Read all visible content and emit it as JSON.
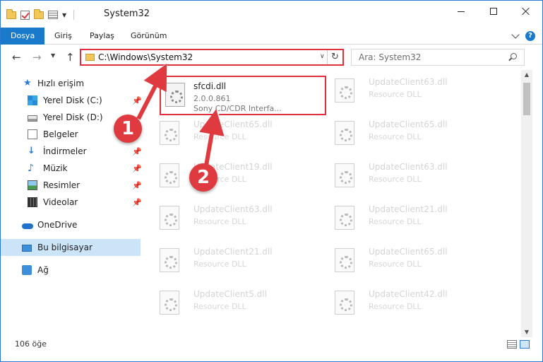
{
  "window": {
    "title": "System32",
    "controls": {
      "minimize": "minimize",
      "maximize": "maximize",
      "close": "close"
    }
  },
  "ribbon": {
    "tabs": [
      "Dosya",
      "Giriş",
      "Paylaş",
      "Görünüm"
    ]
  },
  "address": {
    "path": "C:\\Windows\\System32"
  },
  "search": {
    "placeholder": "Ara: System32"
  },
  "sidebar": {
    "items": [
      {
        "label": "Hızlı erişim",
        "icon": "star-icon",
        "pinned": false
      },
      {
        "label": "Yerel Disk (C:)",
        "icon": "drive-icon",
        "pinned": true
      },
      {
        "label": "Yerel Disk (D:)",
        "icon": "drive-icon",
        "pinned": false
      },
      {
        "label": "Belgeler",
        "icon": "document-icon",
        "pinned": true
      },
      {
        "label": "İndirmeler",
        "icon": "download-icon",
        "pinned": true
      },
      {
        "label": "Müzik",
        "icon": "music-icon",
        "pinned": true
      },
      {
        "label": "Resimler",
        "icon": "pictures-icon",
        "pinned": true
      },
      {
        "label": "Videolar",
        "icon": "videos-icon",
        "pinned": true
      },
      {
        "label": "OneDrive",
        "icon": "cloud-icon",
        "pinned": false
      },
      {
        "label": "Bu bilgisayar",
        "icon": "computer-icon",
        "pinned": false
      },
      {
        "label": "Ağ",
        "icon": "network-icon",
        "pinned": false
      }
    ]
  },
  "files": {
    "main": {
      "name": "sfcdi.dll",
      "version": "2.0.0.861",
      "description": "Sony CD/CDR Interfa..."
    },
    "faded": [
      {
        "name": "UpdateClient63.dll",
        "type": "Resource DLL"
      },
      {
        "name": "UpdateClient65.dll",
        "type": "Resource DLL"
      },
      {
        "name": "UpdateClient65.dll",
        "type": "Resource DLL"
      },
      {
        "name": "UpdateClient19.dll",
        "type": "Resource DLL"
      },
      {
        "name": "UpdateClient63.dll",
        "type": "Resource DLL"
      },
      {
        "name": "UpdateClient63.dll",
        "type": "Resource DLL"
      },
      {
        "name": "UpdateClient21.dll",
        "type": "Resource DLL"
      },
      {
        "name": "UpdateClient21.dll",
        "type": "Resource DLL"
      },
      {
        "name": "UpdateClient65.dll",
        "type": "Resource DLL"
      },
      {
        "name": "UpdateClient5.dll",
        "type": "Resource DLL"
      },
      {
        "name": "UpdateClient42.dll",
        "type": "Resource DLL"
      }
    ]
  },
  "status": {
    "count": "106 öğe"
  },
  "annotations": {
    "step1": "1",
    "step2": "2",
    "color": "#df3a3f"
  },
  "colors": {
    "accent": "#1979ca",
    "highlight": "#e0303b",
    "selected": "#cce4f7"
  }
}
